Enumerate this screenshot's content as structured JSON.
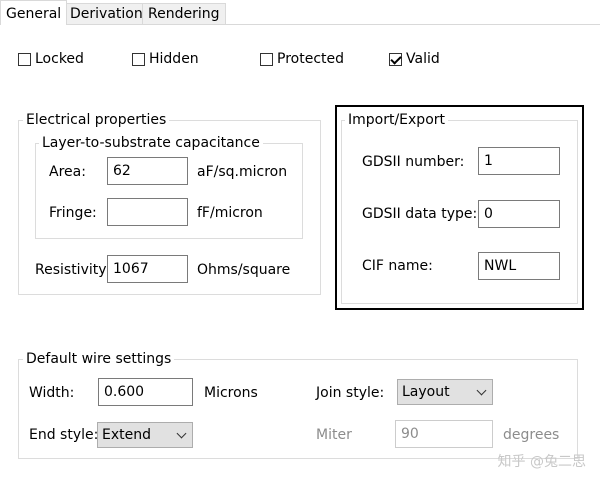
{
  "tabs": [
    "General",
    "Derivation",
    "Rendering"
  ],
  "flags": {
    "locked": {
      "label": "Locked",
      "checked": false
    },
    "hidden": {
      "label": "Hidden",
      "checked": false
    },
    "protected": {
      "label": "Protected",
      "checked": false
    },
    "valid": {
      "label": "Valid",
      "checked": true
    }
  },
  "electrical": {
    "title": "Electrical properties",
    "capacitance_title": "Layer-to-substrate capacitance",
    "area_label": "Area:",
    "area_value": "62",
    "area_unit": "aF/sq.micron",
    "fringe_label": "Fringe:",
    "fringe_value": "",
    "fringe_unit": "fF/micron",
    "resistivity_label": "Resistivity",
    "resistivity_value": "1067",
    "resistivity_unit": "Ohms/square"
  },
  "import_export": {
    "title": "Import/Export",
    "gds_number_label": "GDSII number:",
    "gds_number_value": "1",
    "gds_type_label": "GDSII data type:",
    "gds_type_value": "0",
    "cif_label": "CIF name:",
    "cif_value": "NWL"
  },
  "wire": {
    "title": "Default wire settings",
    "width_label": "Width:",
    "width_value": "0.600",
    "width_unit": "Microns",
    "join_label": "Join style:",
    "join_value": "Layout",
    "end_label": "End style:",
    "end_value": "Extend",
    "miter_label": "Miter",
    "miter_value": "90",
    "miter_unit": "degrees"
  },
  "watermark": "知乎 @兔二思"
}
